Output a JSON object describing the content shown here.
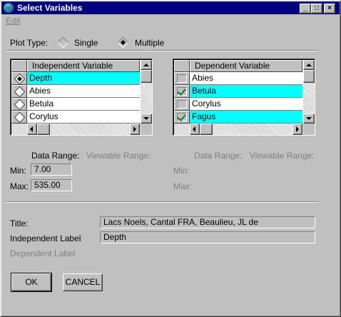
{
  "window": {
    "title": "Select Variables",
    "minimize_glyph": "_",
    "maximize_glyph": "□",
    "close_glyph": "×"
  },
  "menu": {
    "edit": "Edit"
  },
  "plot_type": {
    "label": "Plot Type:",
    "options": [
      "Single",
      "Multiple"
    ],
    "selected": "Multiple"
  },
  "independent_table": {
    "header": "Independent Variable",
    "rows": [
      {
        "name": "Depth",
        "selected": true
      },
      {
        "name": "Abies",
        "selected": false
      },
      {
        "name": "Betula",
        "selected": false
      },
      {
        "name": "Corylus",
        "selected": false
      }
    ]
  },
  "dependent_table": {
    "header": "Dependent Variable",
    "rows": [
      {
        "name": "Abies",
        "checked": false
      },
      {
        "name": "Betula",
        "checked": true
      },
      {
        "name": "Corylus",
        "checked": false
      },
      {
        "name": "Fagus",
        "checked": true
      }
    ]
  },
  "ranges": {
    "left": {
      "data_range": "Data Range:",
      "viewable_range": "Viewable Range:",
      "min_label": "Min:",
      "max_label": "Max:",
      "min_value": "7.00",
      "max_value": "535.00"
    },
    "right": {
      "data_range": "Data Range:",
      "viewable_range": "Viewable Range:",
      "min_label": "Min:",
      "max_label": "Max:"
    }
  },
  "labels": {
    "title_label": "Title:",
    "title_value": "Lacs Noels, Cantal FRA, Beaulieu, JL de",
    "independent_label": "Independent Label",
    "independent_value": "Depth",
    "dependent_label": "Dependent Label"
  },
  "buttons": {
    "ok": "OK",
    "cancel": "CANCEL"
  },
  "colors": {
    "title_bar": "#000080",
    "selection": "#00ffff",
    "window": "#c0c0c0"
  },
  "icons": [
    "globe-icon",
    "minimize-icon",
    "maximize-icon",
    "close-icon",
    "checkmark-icon"
  ]
}
